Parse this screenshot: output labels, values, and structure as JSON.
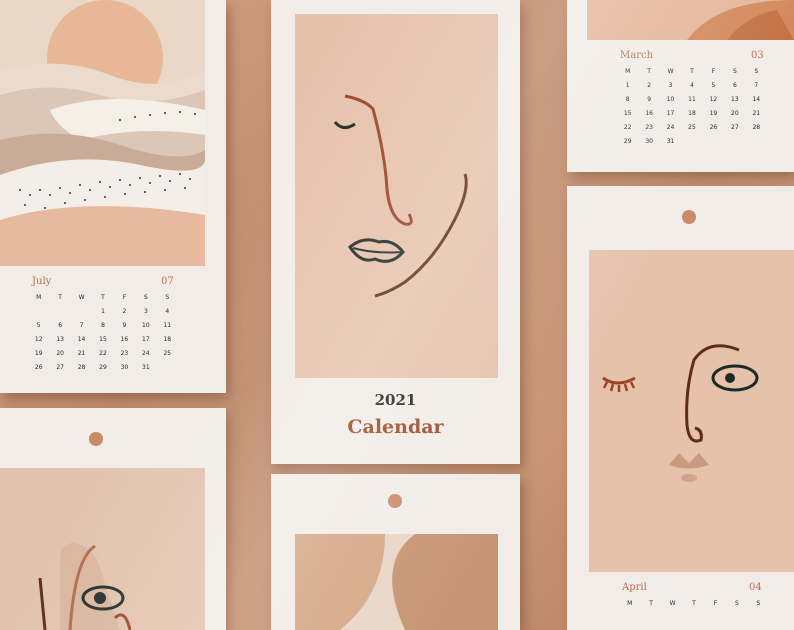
{
  "cover": {
    "year": "2021",
    "title": "Calendar"
  },
  "weekday_headers": [
    "M",
    "T",
    "W",
    "T",
    "F",
    "S",
    "S"
  ],
  "july": {
    "month": "July",
    "number": "07",
    "rows": [
      [
        "",
        "",
        "",
        "1",
        "2",
        "3",
        "4"
      ],
      [
        "5",
        "6",
        "7",
        "8",
        "9",
        "10",
        "11"
      ],
      [
        "12",
        "13",
        "14",
        "15",
        "16",
        "17",
        "18"
      ],
      [
        "19",
        "20",
        "21",
        "22",
        "23",
        "24",
        "25"
      ],
      [
        "26",
        "27",
        "28",
        "29",
        "30",
        "31",
        ""
      ]
    ]
  },
  "march": {
    "month": "March",
    "number": "03",
    "rows": [
      [
        "1",
        "2",
        "3",
        "4",
        "5",
        "6",
        "7"
      ],
      [
        "8",
        "9",
        "10",
        "11",
        "12",
        "13",
        "14"
      ],
      [
        "15",
        "16",
        "17",
        "18",
        "19",
        "20",
        "21"
      ],
      [
        "22",
        "23",
        "24",
        "25",
        "26",
        "27",
        "28"
      ],
      [
        "29",
        "30",
        "31",
        "",
        "",
        "",
        ""
      ]
    ]
  },
  "april": {
    "month": "April",
    "number": "04",
    "weekdays": [
      "M",
      "T",
      "W",
      "T",
      "F",
      "S",
      "S"
    ]
  },
  "colors": {
    "paper": "#f1ece7",
    "terracotta": "#b96f4b",
    "line_dark": "#1f2a26",
    "line_rust": "#9a4326",
    "peach": "#e8c4ac"
  }
}
